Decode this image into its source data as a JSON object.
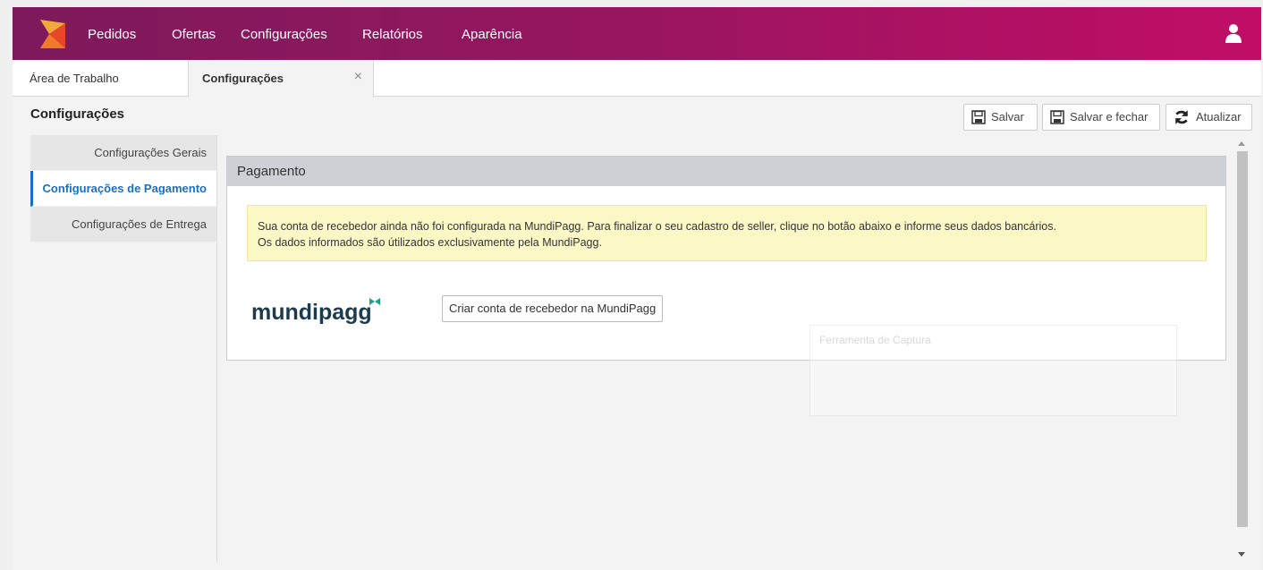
{
  "nav": {
    "items": [
      "Pedidos",
      "Ofertas",
      "Configurações",
      "Relatórios",
      "Aparência"
    ]
  },
  "tabs": [
    {
      "label": "Área de Trabalho"
    },
    {
      "label": "Configurações"
    }
  ],
  "page": {
    "title": "Configurações"
  },
  "toolbar": {
    "save_label": "Salvar",
    "save_close_label": "Salvar e fechar",
    "refresh_label": "Atualizar"
  },
  "sidebar": {
    "items": [
      {
        "label": "Configurações Gerais"
      },
      {
        "label": "Configurações de Pagamento"
      },
      {
        "label": "Configurações de Entrega"
      }
    ]
  },
  "panel": {
    "title": "Pagamento",
    "alert_line1": "Sua conta de recebedor ainda não foi configurada na MundiPagg. Para finalizar o seu cadastro de seller, clique no botão abaixo e informe seus dados bancários.",
    "alert_line2": "Os dados informados são útilizados exclusivamente pela MundiPagg.",
    "logo_text": "mundipagg",
    "button_label": "Criar conta de recebedor na MundiPagg"
  },
  "overlay": {
    "title": "Ferramenta de Captura"
  },
  "colors": {
    "brand_start": "#7d1a5b",
    "brand_end": "#c10e66",
    "active_link": "#1a6fc4",
    "alert_bg": "#fcf8c6",
    "mundipagg_teal": "#1fa08e"
  }
}
